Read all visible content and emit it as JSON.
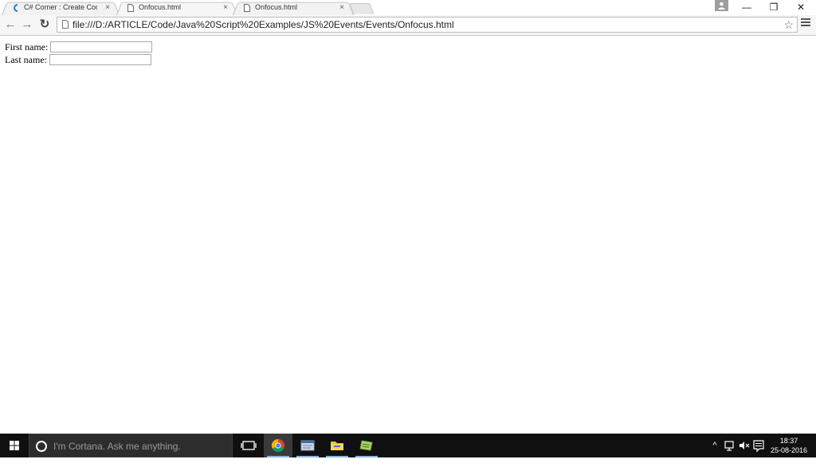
{
  "browser": {
    "tabs": [
      {
        "title": "C# Corner : Create Code S",
        "active": false,
        "favicon": "csharp-corner-icon"
      },
      {
        "title": "Onfocus.html",
        "active": true,
        "favicon": "page-icon"
      },
      {
        "title": "Onfocus.html",
        "active": false,
        "favicon": "page-icon"
      }
    ],
    "tab_close": "×",
    "window_controls": {
      "minimize": "—",
      "restore": "❐",
      "close": "✕"
    },
    "nav": {
      "back": "←",
      "forward": "→",
      "reload": "↻"
    },
    "url": "file:///D:/ARTICLE/Code/Java%20Script%20Examples/JS%20Events/Events/Onfocus.html",
    "star": "☆"
  },
  "form": {
    "first_name_label": "First name:",
    "first_name_value": "",
    "last_name_label": "Last name:",
    "last_name_value": ""
  },
  "taskbar": {
    "search_placeholder": "I'm Cortana. Ask me anything.",
    "pinned": [
      "task-view-icon",
      "chrome-icon",
      "notepad-icon",
      "file-explorer-icon",
      "notepad-plus-icon"
    ],
    "tray": {
      "chevron": "^",
      "network": "🖧",
      "volume": "🔇",
      "notifications": "▤"
    },
    "time": "18:37",
    "date": "25-08-2016"
  },
  "colors": {
    "taskbar_bg": "#101010",
    "search_bg": "#2d2d2d",
    "accent": "#8bb4e0"
  }
}
